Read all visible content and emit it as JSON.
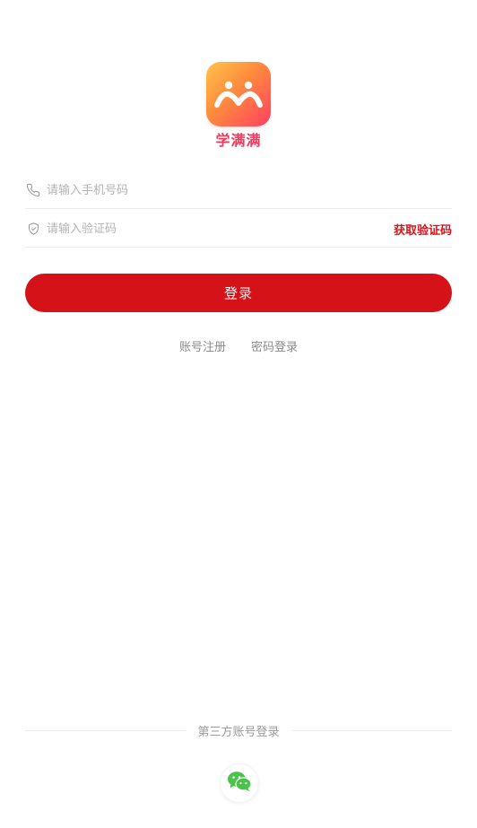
{
  "brand": {
    "logo_icon": "app-logo-icon",
    "name": "学满满",
    "gradient": [
      "#ffc34a",
      "#ff8a3d",
      "#ff3f63"
    ],
    "name_color": "#ef3b5d"
  },
  "form": {
    "phone": {
      "icon": "phone-icon",
      "placeholder": "请输入手机号码",
      "value": ""
    },
    "code": {
      "icon": "shield-icon",
      "placeholder": "请输入验证码",
      "value": "",
      "get_code_label": "获取验证码"
    },
    "login_label": "登录",
    "accent_color": "#d41217"
  },
  "links": {
    "register_label": "账号注册",
    "password_login_label": "密码登录"
  },
  "third_party": {
    "label": "第三方账号登录",
    "wechat_icon": "wechat-icon",
    "wechat_color": "#4cc24c"
  }
}
